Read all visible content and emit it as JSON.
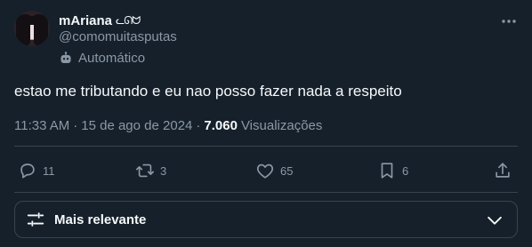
{
  "author": {
    "display_name": "mAriana",
    "name_emoji": "ᓚᘏᗢ",
    "handle": "@comomuitasputas",
    "automated_label": "Automático"
  },
  "tweet": {
    "text": "estao me tributando e eu nao posso fazer nada a respeito",
    "time": "11:33 AM",
    "date": "15 de ago de 2024",
    "views_count": "7.060",
    "views_label": "Visualizações"
  },
  "actions": {
    "replies": "11",
    "reposts": "3",
    "likes": "65",
    "bookmarks": "6"
  },
  "sort": {
    "label": "Mais relevante"
  },
  "colors": {
    "background": "#15202b",
    "text_primary": "#f7f9f9",
    "text_secondary": "#8b98a5",
    "border": "#38444d"
  }
}
